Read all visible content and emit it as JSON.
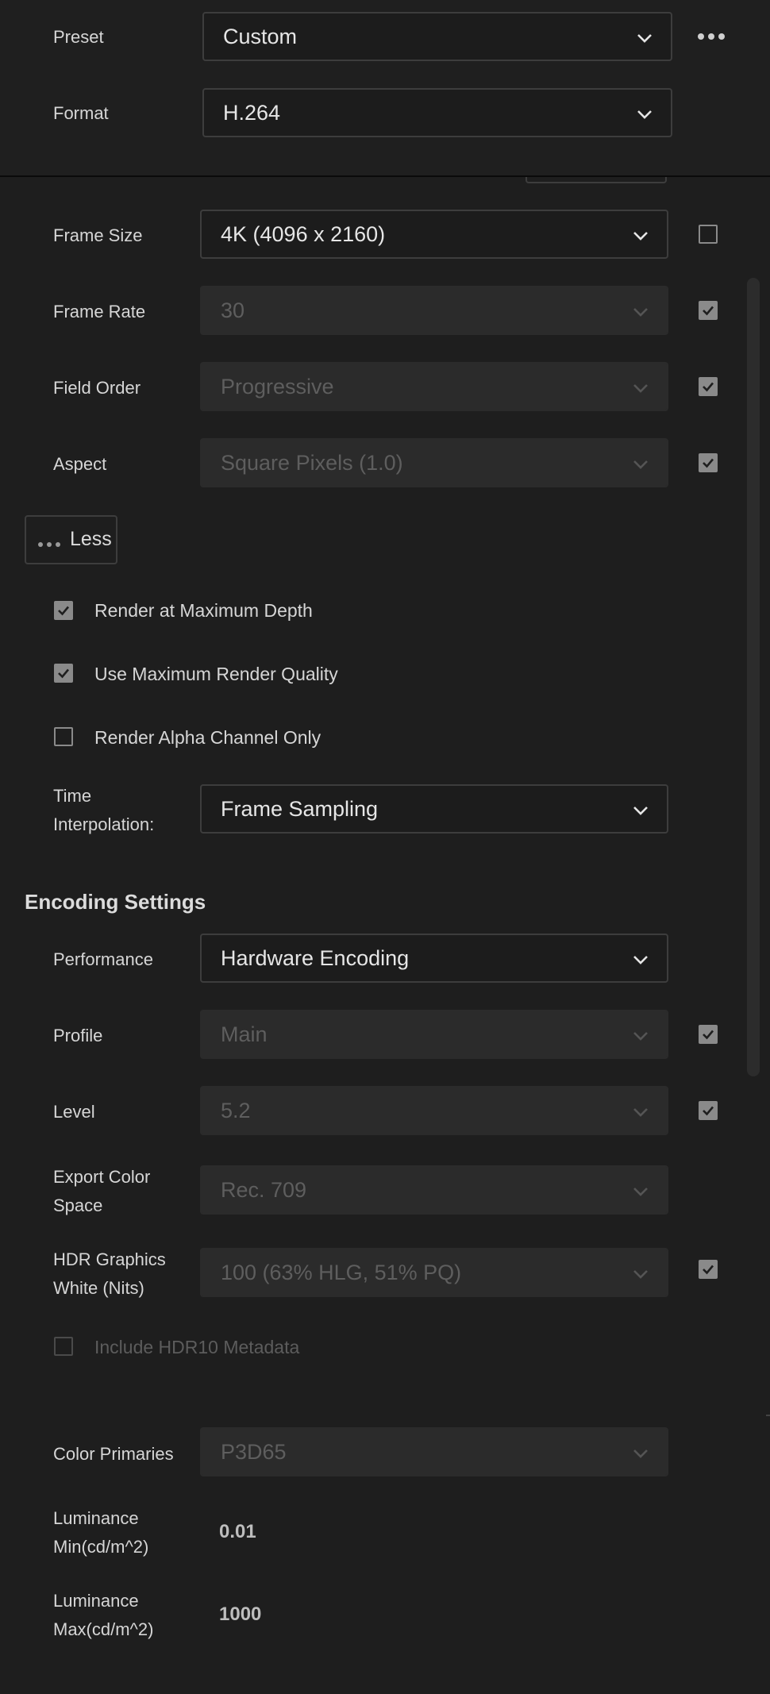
{
  "header": {
    "preset_label": "Preset",
    "preset_value": "Custom",
    "format_label": "Format",
    "format_value": "H.264",
    "more_icon": "more-horizontal-icon"
  },
  "video": {
    "frame_size": {
      "label": "Frame Size",
      "value": "4K (4096 x 2160)",
      "match_source": false
    },
    "frame_rate": {
      "label": "Frame Rate",
      "value": "30",
      "match_source": true
    },
    "field_order": {
      "label": "Field Order",
      "value": "Progressive",
      "match_source": true
    },
    "aspect": {
      "label": "Aspect",
      "value": "Square Pixels (1.0)",
      "match_source": true
    },
    "less_button": "Less",
    "render_max_depth": {
      "label": "Render at Maximum Depth",
      "checked": true
    },
    "max_render_quality": {
      "label": "Use Maximum Render Quality",
      "checked": true
    },
    "alpha_only": {
      "label": "Render Alpha Channel Only",
      "checked": false
    },
    "time_interpolation": {
      "label_line1": "Time",
      "label_line2": "Interpolation:",
      "value": "Frame Sampling"
    }
  },
  "encoding": {
    "title": "Encoding Settings",
    "performance": {
      "label": "Performance",
      "value": "Hardware Encoding"
    },
    "profile": {
      "label": "Profile",
      "value": "Main",
      "match_source": true
    },
    "level": {
      "label": "Level",
      "value": "5.2",
      "match_source": true
    },
    "color_space": {
      "label_line1": "Export Color",
      "label_line2": "Space",
      "value": "Rec. 709"
    },
    "hdr_white": {
      "label_line1": "HDR Graphics",
      "label_line2": "White (Nits)",
      "value": "100 (63% HLG, 51% PQ)",
      "match_source": true
    },
    "hdr10_metadata": {
      "label": "Include HDR10 Metadata",
      "checked": false
    },
    "color_primaries": {
      "label": "Color Primaries",
      "value": "P3D65"
    },
    "lum_min": {
      "label_line1": "Luminance",
      "label_line2": "Min(cd/m^2)",
      "value": "0.01"
    },
    "lum_max": {
      "label_line1": "Luminance",
      "label_line2": "Max(cd/m^2)",
      "value": "1000"
    }
  },
  "colors": {
    "background": "#1e1e1e",
    "field": "#1c1c1c",
    "field_disabled": "#2b2b2b",
    "checkbox": "#8a8a8a"
  }
}
